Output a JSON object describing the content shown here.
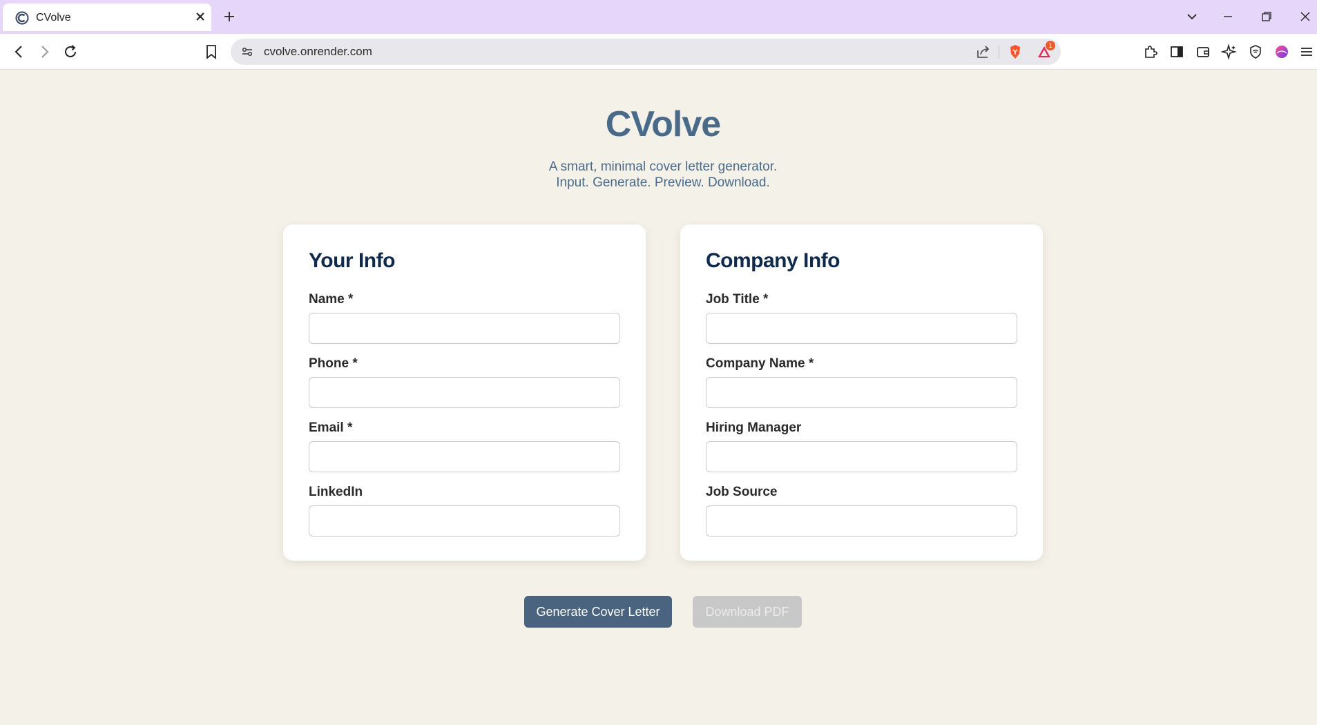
{
  "browser": {
    "tab_title": "CVolve",
    "url": "cvolve.onrender.com",
    "notification_count": "1"
  },
  "header": {
    "title": "CVolve",
    "tagline_line1": "A smart, minimal cover letter generator.",
    "tagline_line2": "Input. Generate. Preview. Download."
  },
  "your_info": {
    "title": "Your Info",
    "fields": [
      {
        "label": "Name *",
        "value": ""
      },
      {
        "label": "Phone *",
        "value": ""
      },
      {
        "label": "Email *",
        "value": ""
      },
      {
        "label": "LinkedIn",
        "value": ""
      }
    ]
  },
  "company_info": {
    "title": "Company Info",
    "fields": [
      {
        "label": "Job Title *",
        "value": ""
      },
      {
        "label": "Company Name *",
        "value": ""
      },
      {
        "label": "Hiring Manager",
        "value": ""
      },
      {
        "label": "Job Source",
        "value": ""
      }
    ]
  },
  "actions": {
    "generate_label": "Generate Cover Letter",
    "download_label": "Download PDF",
    "download_disabled": true
  },
  "colors": {
    "accent": "#4a6a8a",
    "heading": "#102a4c",
    "background": "#f4f1e8",
    "tabbar": "#e6d6fa"
  }
}
